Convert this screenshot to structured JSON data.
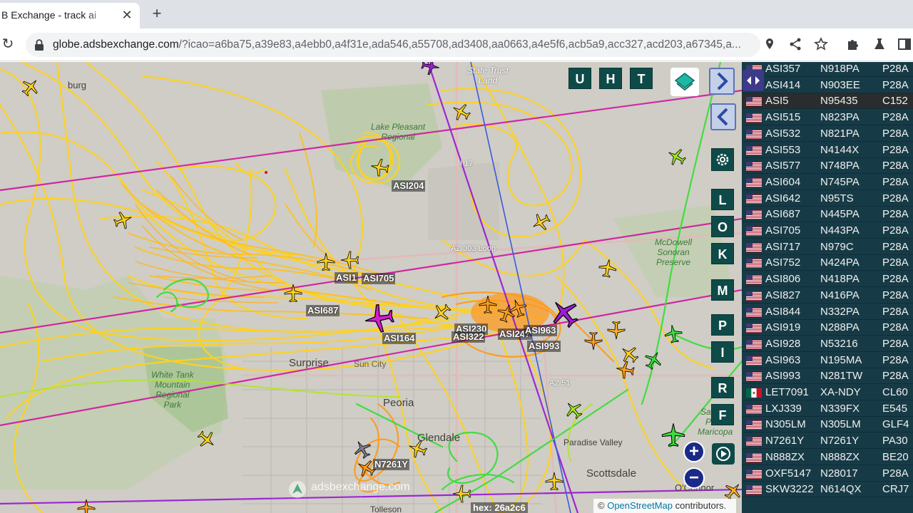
{
  "browser": {
    "tab_title": "B Exchange - track ai",
    "tab_close": "✕",
    "new_tab": "+",
    "url_domain": "globe.adsbexchange.com",
    "url_rest": "/?icao=a6ba75,a39e83,a4ebb0,a4f31e,ada546,a55708,ad3408,aa0663,a4e5f6,acb5a9,acc327,acd203,a67345,a..."
  },
  "map": {
    "places": [
      {
        "name": "Surprise"
      },
      {
        "name": "Sun City"
      },
      {
        "name": "Peoria"
      },
      {
        "name": "Glendale"
      },
      {
        "name": "Scottsdale"
      },
      {
        "name": "Paradise Valley"
      },
      {
        "name": "Tolleson"
      },
      {
        "name": "O'Connor"
      },
      {
        "name": "burg"
      }
    ],
    "parks": {
      "white_tank": "White Tank\nMountain\nRegional\nPark",
      "state_trust": "State Trust\nLand",
      "mcdowell": "McDowell\nSonoran\nPreserve",
      "salt_river": "Salt Riv\nPima\nMaricopa",
      "lake_pleasant": "Lake Pleasant\nRegional"
    },
    "road_labels": {
      "loop": "AZ 303 Loop",
      "az51": "AZ 51",
      "az17": "I 17"
    },
    "aircraft_labels": [
      {
        "text": "ASI204"
      },
      {
        "text": "ASI1"
      },
      {
        "text": "ASI705"
      },
      {
        "text": "ASI687"
      },
      {
        "text": "ASI164"
      },
      {
        "text": "ASI230"
      },
      {
        "text": "ASI322"
      },
      {
        "text": "ASI247"
      },
      {
        "text": "ASI963"
      },
      {
        "text": "ASI993"
      },
      {
        "text": "N7261Y"
      }
    ],
    "buttons": {
      "top": [
        "U",
        "H",
        "T"
      ],
      "side": [
        "L",
        "O",
        "K",
        "M",
        "P",
        "I",
        "R",
        "F"
      ],
      "zoom_in": "+",
      "zoom_out": "−"
    },
    "watermark": "adsbexchange.com",
    "attribution_prefix": "©",
    "attribution_link": "OpenStreetMap",
    "attribution_suffix": "contributors.",
    "hex_label": "hex: 26a2c6"
  },
  "aircraft_list": [
    {
      "callsign": "ASI357",
      "reg": "N918PA",
      "type": "P28A",
      "flag": "us"
    },
    {
      "callsign": "ASI414",
      "reg": "N903EE",
      "type": "P28A",
      "flag": "us"
    },
    {
      "callsign": "ASI5",
      "reg": "N95435",
      "type": "C152",
      "flag": "us",
      "selected": true
    },
    {
      "callsign": "ASI515",
      "reg": "N823PA",
      "type": "P28A",
      "flag": "us"
    },
    {
      "callsign": "ASI532",
      "reg": "N821PA",
      "type": "P28A",
      "flag": "us"
    },
    {
      "callsign": "ASI553",
      "reg": "N4144X",
      "type": "P28A",
      "flag": "us"
    },
    {
      "callsign": "ASI577",
      "reg": "N748PA",
      "type": "P28A",
      "flag": "us"
    },
    {
      "callsign": "ASI604",
      "reg": "N745PA",
      "type": "P28A",
      "flag": "us"
    },
    {
      "callsign": "ASI642",
      "reg": "N95TS",
      "type": "P28A",
      "flag": "us"
    },
    {
      "callsign": "ASI687",
      "reg": "N445PA",
      "type": "P28A",
      "flag": "us"
    },
    {
      "callsign": "ASI705",
      "reg": "N443PA",
      "type": "P28A",
      "flag": "us"
    },
    {
      "callsign": "ASI717",
      "reg": "N979C",
      "type": "P28A",
      "flag": "us"
    },
    {
      "callsign": "ASI752",
      "reg": "N424PA",
      "type": "P28A",
      "flag": "us"
    },
    {
      "callsign": "ASI806",
      "reg": "N418PA",
      "type": "P28A",
      "flag": "us"
    },
    {
      "callsign": "ASI827",
      "reg": "N416PA",
      "type": "P28A",
      "flag": "us"
    },
    {
      "callsign": "ASI844",
      "reg": "N332PA",
      "type": "P28A",
      "flag": "us"
    },
    {
      "callsign": "ASI919",
      "reg": "N288PA",
      "type": "P28A",
      "flag": "us"
    },
    {
      "callsign": "ASI928",
      "reg": "N53216",
      "type": "P28A",
      "flag": "us"
    },
    {
      "callsign": "ASI963",
      "reg": "N195MA",
      "type": "P28A",
      "flag": "us"
    },
    {
      "callsign": "ASI993",
      "reg": "N281TW",
      "type": "P28A",
      "flag": "us"
    },
    {
      "callsign": "LET7091",
      "reg": "XA-NDY",
      "type": "CL60",
      "flag": "mx"
    },
    {
      "callsign": "LXJ339",
      "reg": "N339FX",
      "type": "E545",
      "flag": "us"
    },
    {
      "callsign": "N305LM",
      "reg": "N305LM",
      "type": "GLF4",
      "flag": "us"
    },
    {
      "callsign": "N7261Y",
      "reg": "N7261Y",
      "type": "PA30",
      "flag": "us"
    },
    {
      "callsign": "N888ZX",
      "reg": "N888ZX",
      "type": "BE20",
      "flag": "us"
    },
    {
      "callsign": "OXF5147",
      "reg": "N28017",
      "type": "P28A",
      "flag": "us"
    },
    {
      "callsign": "SKW3222",
      "reg": "N614QX",
      "type": "CRJ7",
      "flag": "us"
    }
  ],
  "colors": {
    "track_yellow": "#ffd21e",
    "track_orange": "#ff9b1e",
    "track_magenta": "#d21ea0",
    "track_purple": "#9b1ed2",
    "track_green": "#3cdc3c",
    "list_bg": "#173b46",
    "button_teal": "#0e4a48"
  }
}
